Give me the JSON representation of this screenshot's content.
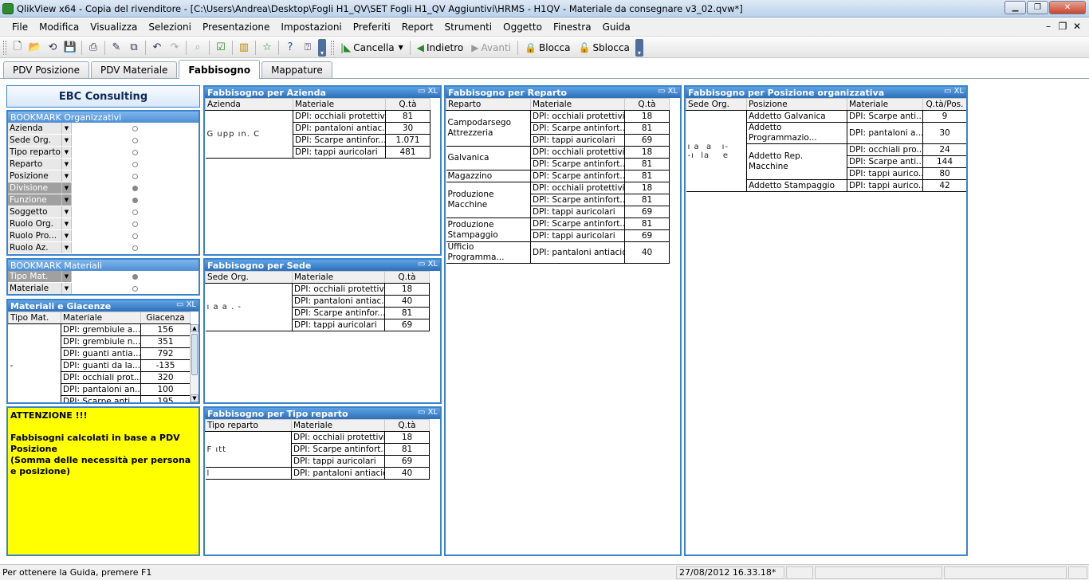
{
  "window": {
    "title": "QlikView x64 - Copia del rivenditore - [C:\\Users\\Andrea\\Desktop\\Fogli H1_QV\\SET Fogli  H1_QV Aggiuntivi\\HRMS - H1QV - Materiale da consegnare v3_02.qvw*]"
  },
  "menu": [
    "File",
    "Modifica",
    "Visualizza",
    "Selezioni",
    "Presentazione",
    "Impostazioni",
    "Preferiti",
    "Report",
    "Strumenti",
    "Oggetto",
    "Finestra",
    "Guida"
  ],
  "toolbar": {
    "cancella": "Cancella",
    "indietro": "Indietro",
    "avanti": "Avanti",
    "blocca": "Blocca",
    "sblocca": "Sblocca"
  },
  "tabs": [
    "PDV Posizione",
    "PDV Materiale",
    "Fabbisogno",
    "Mappature"
  ],
  "active_tab": "Fabbisogno",
  "ebc": "EBC Consulting",
  "bookmark_org": {
    "title": "BOOKMARK Organizzativi",
    "items": [
      {
        "label": "Azienda",
        "state": "off"
      },
      {
        "label": "Sede Org.",
        "state": "off"
      },
      {
        "label": "Tipo reparto",
        "state": "off"
      },
      {
        "label": "Reparto",
        "state": "off"
      },
      {
        "label": "Posizione",
        "state": "off"
      },
      {
        "label": "Divisione",
        "state": "on"
      },
      {
        "label": "Funzione",
        "state": "on"
      },
      {
        "label": "Soggetto",
        "state": "off"
      },
      {
        "label": "Ruolo Org.",
        "state": "off"
      },
      {
        "label": "Ruolo Pro...",
        "state": "off"
      },
      {
        "label": "Ruolo Az.",
        "state": "off"
      }
    ]
  },
  "bookmark_mat": {
    "title": "BOOKMARK Materiali",
    "items": [
      {
        "label": "Tipo Mat.",
        "state": "on"
      },
      {
        "label": "Materiale",
        "state": "off"
      }
    ]
  },
  "giacenze": {
    "title": "Materiali e Giacenze",
    "headers": [
      "Tipo Mat.",
      "Materiale",
      "Giacenza"
    ],
    "group": "-",
    "rows": [
      [
        "DPI: grembiule a...",
        "156"
      ],
      [
        "DPI: grembiule n...",
        "351"
      ],
      [
        "DPI: guanti antia...",
        "792"
      ],
      [
        "DPI: guanti da la...",
        "-135"
      ],
      [
        "DPI: occhiali prot...",
        "320"
      ],
      [
        "DPI: pantaloni an...",
        "100"
      ],
      [
        "DPI: Scarpe anti...",
        "195"
      ]
    ]
  },
  "attention": {
    "line1": "ATTENZIONE !!!",
    "line2": "Fabbisogni calcolati in base a PDV Posizione",
    "line3": "(Somma delle necessità per persona e posizione)"
  },
  "azienda": {
    "title": "Fabbisogno per Azienda",
    "headers": [
      "Azienda",
      "Materiale",
      "Q.tà"
    ],
    "group": "G upp  ın. C",
    "rows": [
      [
        "DPI: occhiali protettivi",
        "81"
      ],
      [
        "DPI: pantaloni antiac...",
        "30"
      ],
      [
        "DPI: Scarpe antinfor...",
        "1.071"
      ],
      [
        "DPI: tappi auricolari",
        "481"
      ]
    ]
  },
  "sede": {
    "title": "Fabbisogno per Sede",
    "headers": [
      "Sede Org.",
      "Materiale",
      "Q.tà"
    ],
    "group": "ı a  a  . -",
    "rows": [
      [
        "DPI: occhiali protettivi",
        "18"
      ],
      [
        "DPI: pantaloni antiac...",
        "40"
      ],
      [
        "DPI: Scarpe antinfor...",
        "81"
      ],
      [
        "DPI: tappi auricolari",
        "69"
      ]
    ]
  },
  "tiporeparto": {
    "title": "Fabbisogno per Tipo reparto",
    "headers": [
      "Tipo reparto",
      "Materiale",
      "Q.tà"
    ],
    "group1": "F    ıtt",
    "group2": "l",
    "rows": [
      [
        "DPI: occhiali protettivi",
        "18"
      ],
      [
        "DPI: Scarpe antinfort...",
        "81"
      ],
      [
        "DPI: tappi auricolari",
        "69"
      ],
      [
        "DPI: pantaloni antiacido",
        "40"
      ]
    ]
  },
  "reparto": {
    "title": "Fabbisogno per Reparto",
    "headers": [
      "Reparto",
      "Materiale",
      "Q.tà"
    ],
    "groups": [
      {
        "name": "Campodarsego Attrezzeria",
        "rows": [
          [
            "DPI: occhiali protettivi",
            "18"
          ],
          [
            "DPI: Scarpe antinfort...",
            "81"
          ],
          [
            "DPI: tappi auricolari",
            "69"
          ]
        ]
      },
      {
        "name": "Galvanica",
        "rows": [
          [
            "DPI: occhiali protettivi",
            "18"
          ],
          [
            "DPI: Scarpe antinfort...",
            "81"
          ]
        ]
      },
      {
        "name": "Magazzino",
        "rows": [
          [
            "DPI: Scarpe antinfort...",
            "81"
          ]
        ]
      },
      {
        "name": "Produzione Macchine",
        "rows": [
          [
            "DPI: occhiali protettivi",
            "18"
          ],
          [
            "DPI: Scarpe antinfort...",
            "81"
          ],
          [
            "DPI: tappi auricolari",
            "69"
          ]
        ]
      },
      {
        "name": "Produzione Stampaggio",
        "rows": [
          [
            "DPI: Scarpe antinfort...",
            "81"
          ],
          [
            "DPI: tappi auricolari",
            "69"
          ]
        ]
      },
      {
        "name": "Ufficio Programma...",
        "rows": [
          [
            "DPI: pantaloni antiacido",
            "40"
          ]
        ]
      }
    ]
  },
  "posizione": {
    "title": "Fabbisogno per Posizione organizzativa",
    "headers": [
      "Sede Org.",
      "Posizione",
      "Materiale",
      "Q.tà/Pos."
    ],
    "sede": "ı a  a   ı-\n-ı  la    e",
    "groups": [
      {
        "name": "Addetto Galvanica",
        "rows": [
          [
            "DPI: Scarpe anti...",
            "9"
          ]
        ]
      },
      {
        "name": "Addetto Programmazio...",
        "rows": [
          [
            "DPI: pantaloni a...",
            "30"
          ]
        ]
      },
      {
        "name": "Addetto Rep. Macchine",
        "rows": [
          [
            "DPI: occhiali pro...",
            "24"
          ],
          [
            "DPI: Scarpe anti...",
            "144"
          ],
          [
            "DPI: tappi aurico...",
            "80"
          ]
        ]
      },
      {
        "name": "Addetto Stampaggio",
        "rows": [
          [
            "DPI: tappi aurico...",
            "42"
          ]
        ]
      }
    ]
  },
  "status": {
    "help": "Per ottenere la Guida, premere F1",
    "datetime": "27/08/2012 16.33.18*"
  }
}
